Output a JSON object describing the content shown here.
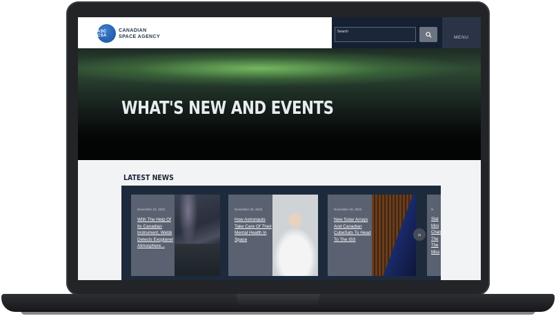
{
  "brand": {
    "logo_text": "ASC CSA",
    "name_line1": "CANADIAN",
    "name_line2": "SPACE AGENCY",
    "accent_color": "#1b4f9a"
  },
  "search": {
    "label": "Search",
    "button_icon": "search-icon"
  },
  "menu": {
    "label": "MENU"
  },
  "hero": {
    "title": "WHAT'S NEW AND EVENTS"
  },
  "news": {
    "heading": "LATEST NEWS",
    "next_icon": "double-chevron-right-icon",
    "items": [
      {
        "date": "November 22, 2022",
        "title": "With The Help Of Its Canadian Instrument, Webb Detects Exoplanet Atmosphere..."
      },
      {
        "date": "November 20, 2022",
        "title": "How Astronauts Take Care Of Their Mental Health In Space"
      },
      {
        "date": "November 18, 2022",
        "title": "New Solar Arrays And Canadian CubeSats To Head To The ISS"
      },
      {
        "date": "N",
        "title": "Stat Mini Chan The The Miss"
      }
    ]
  }
}
